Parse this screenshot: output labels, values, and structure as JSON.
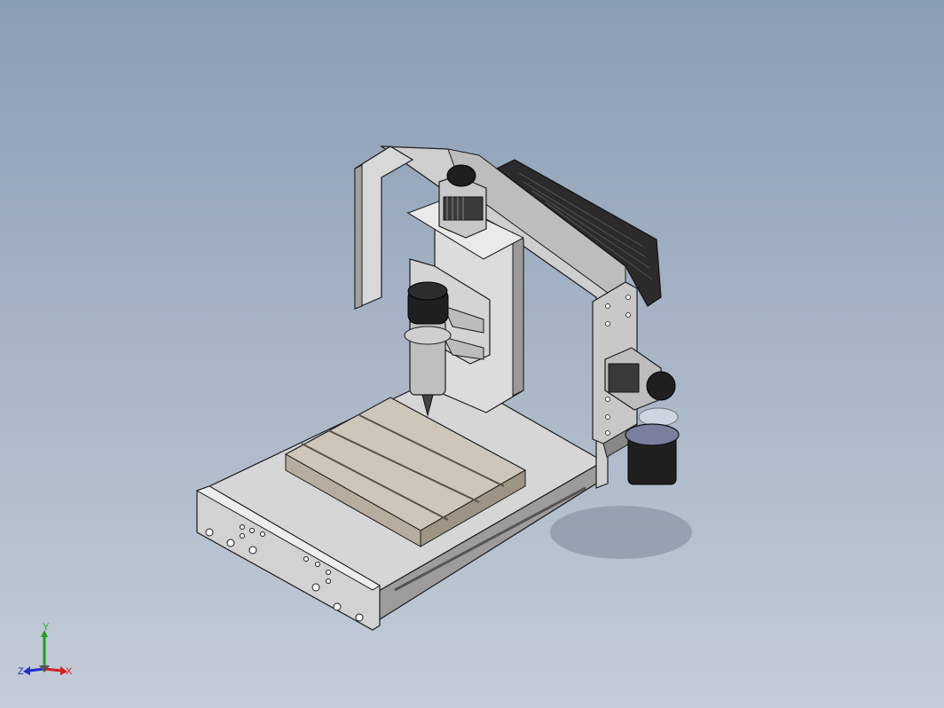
{
  "viewport": {
    "background_top": "#8a9db3",
    "background_bottom": "#c4ccd7"
  },
  "model": {
    "parts": [
      "base-plate",
      "front-panel",
      "t-slot-table",
      "back-upright",
      "left-side-panel",
      "gantry-carriage",
      "z-axis-plate",
      "spindle-motor",
      "z-stepper-motor",
      "x-stepper-motor",
      "cooling-fan",
      "dust-cup"
    ],
    "colors": {
      "frame": "#d9d9d9",
      "frame_shade": "#a8a8a8",
      "frame_dark": "#7c7c7c",
      "table": "#cfc6bb",
      "table_shade": "#b3a999",
      "motor": "#2a2a2a",
      "edge": "#1c1c1c"
    }
  },
  "triad": {
    "x_label": "X",
    "y_label": "Y",
    "z_label": "Z",
    "x_color": "#d42020",
    "y_color": "#1ea01e",
    "z_color": "#2030c8"
  }
}
